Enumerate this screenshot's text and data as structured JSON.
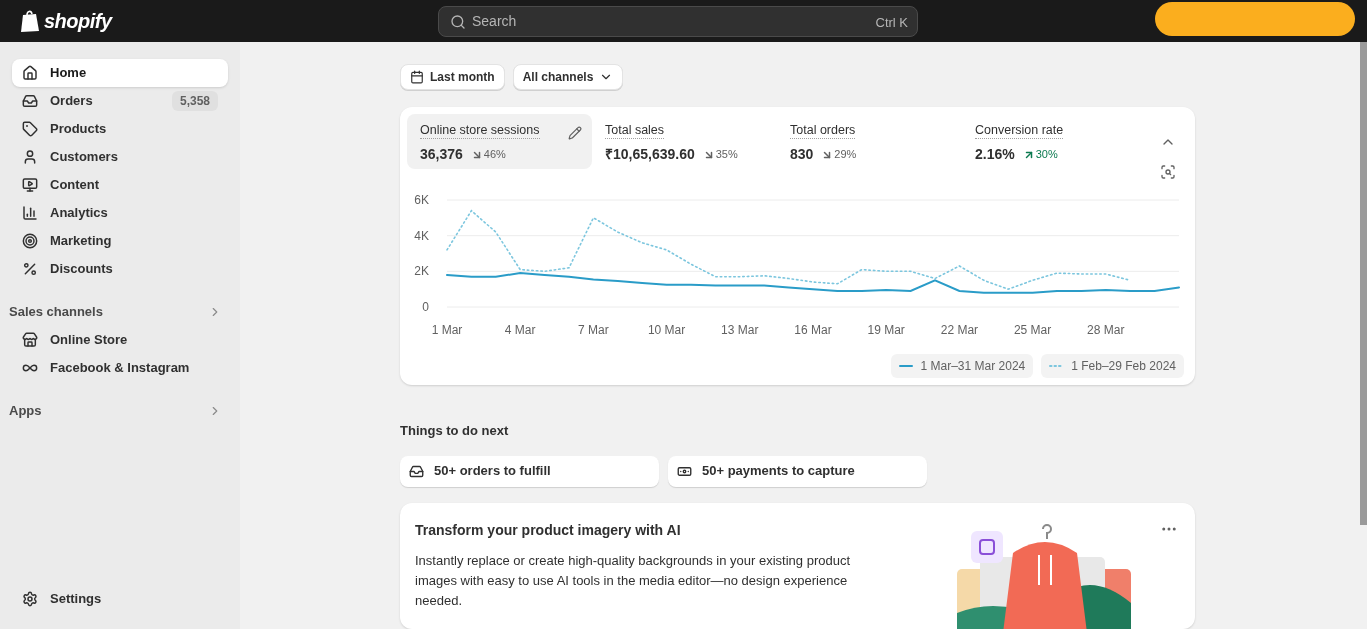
{
  "topbar": {
    "logo": "shopify",
    "search": {
      "placeholder": "Search",
      "shortcut": "Ctrl K"
    }
  },
  "sidebar": {
    "items": [
      {
        "label": "Home",
        "kind": "home",
        "selected": true
      },
      {
        "label": "Orders",
        "kind": "orders",
        "selected": false,
        "badge": "5,358"
      },
      {
        "label": "Products",
        "kind": "tag",
        "selected": false
      },
      {
        "label": "Customers",
        "kind": "person",
        "selected": false
      },
      {
        "label": "Content",
        "kind": "content",
        "selected": false
      },
      {
        "label": "Analytics",
        "kind": "bars",
        "selected": false
      },
      {
        "label": "Marketing",
        "kind": "target",
        "selected": false
      },
      {
        "label": "Discounts",
        "kind": "discount",
        "selected": false
      }
    ],
    "sections": [
      {
        "title": "Sales channels",
        "items": [
          {
            "label": "Online Store",
            "kind": "store",
            "selected": false
          },
          {
            "label": "Facebook & Instagram",
            "kind": "meta",
            "selected": false
          }
        ]
      },
      {
        "title": "Apps"
      }
    ],
    "footer": {
      "label": "Settings",
      "kind": "gear"
    }
  },
  "filters": [
    {
      "label": "Last month",
      "kind": "date"
    },
    {
      "label": "All channels",
      "kind": "dropdown"
    }
  ],
  "metrics": [
    {
      "label": "Online store sessions",
      "value": "36,376",
      "change": "46%",
      "kind": "down",
      "selected": true
    },
    {
      "label": "Total sales",
      "value": "₹10,65,639.60",
      "change": "35%",
      "kind": "down",
      "selected": false
    },
    {
      "label": "Total orders",
      "value": "830",
      "change": "29%",
      "kind": "down",
      "selected": false
    },
    {
      "label": "Conversion rate",
      "value": "2.16%",
      "change": "30%",
      "kind": "up",
      "selected": false
    }
  ],
  "chart_data": {
    "type": "line",
    "categories": [
      "1 Mar",
      null,
      null,
      "4 Mar",
      null,
      null,
      "7 Mar",
      null,
      null,
      "10 Mar",
      null,
      null,
      "13 Mar",
      null,
      null,
      "16 Mar",
      null,
      null,
      "19 Mar",
      null,
      null,
      "22 Mar",
      null,
      null,
      "25 Mar",
      null,
      null,
      "28 Mar",
      null,
      null,
      null
    ],
    "ylim": [
      0,
      6000
    ],
    "legend": "bottom-right",
    "yticks": [
      {
        "value": 0,
        "label": "0"
      },
      {
        "value": 2000,
        "label": "2K"
      },
      {
        "value": 4000,
        "label": "4K"
      },
      {
        "value": 6000,
        "label": "6K"
      }
    ],
    "series": [
      {
        "name": "1 Mar–31 Mar 2024",
        "color": "#2a9cc8",
        "line_style": "solid",
        "values": [
          1800,
          1700,
          1700,
          1900,
          1800,
          1700,
          1550,
          1450,
          1350,
          1250,
          1250,
          1200,
          1200,
          1200,
          1100,
          1000,
          900,
          900,
          950,
          900,
          1500,
          900,
          800,
          800,
          800,
          900,
          900,
          950,
          900,
          900,
          1100
        ]
      },
      {
        "name": "1 Feb–29 Feb 2024",
        "color": "#7cc6de",
        "line_style": "dotted",
        "values": [
          3200,
          5400,
          4200,
          2100,
          2000,
          2200,
          5000,
          4200,
          3600,
          3200,
          2400,
          1700,
          1700,
          1750,
          1600,
          1400,
          1300,
          2100,
          2000,
          2000,
          1600,
          2300,
          1500,
          1000,
          1500,
          1900,
          1850,
          1850,
          1500,
          null,
          null
        ]
      }
    ]
  },
  "todo": {
    "title": "Things to do next",
    "tasks": [
      {
        "label": "50+ orders to fulfill",
        "kind": "inbox"
      },
      {
        "label": "50+ payments to capture",
        "kind": "cash"
      }
    ]
  },
  "promo": {
    "title": "Transform your product imagery with AI",
    "body": "Instantly replace or create high-quality backgrounds in your existing product images with easy to use AI tools in the media editor—no design experience needed."
  }
}
